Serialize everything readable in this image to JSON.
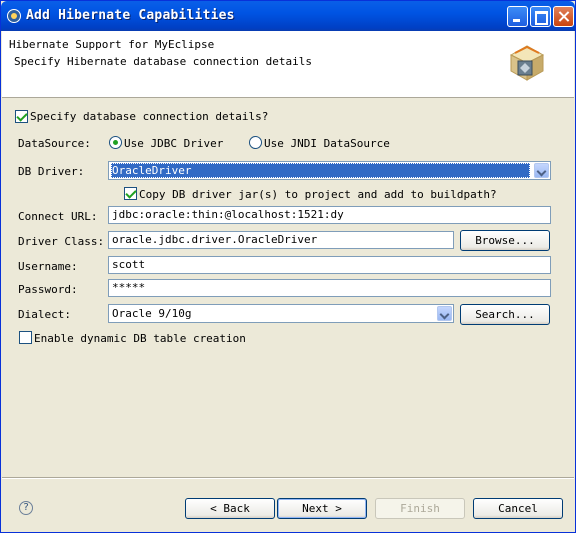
{
  "window": {
    "title": "Add Hibernate Capabilities"
  },
  "header": {
    "title": "Hibernate Support for MyEclipse",
    "description": "Specify Hibernate database connection details",
    "icon": "hibernate-banner-icon"
  },
  "form": {
    "specify_details_label": "Specify database connection details?",
    "specify_details_checked": true,
    "datasource_label": "DataSource:",
    "use_jdbc_label": "Use JDBC Driver",
    "use_jndi_label": "Use JNDI DataSource",
    "selected_source": "jdbc",
    "db_driver_label": "DB Driver:",
    "db_driver_value": "OracleDriver",
    "copy_jar_label": "Copy DB driver jar(s) to project and add to buildpath?",
    "copy_jar_checked": true,
    "connect_url_label": "Connect URL:",
    "connect_url_value": "jdbc:oracle:thin:@localhost:1521:dy",
    "driver_class_label": "Driver Class:",
    "driver_class_value": "oracle.jdbc.driver.OracleDriver",
    "browse_label": "Browse...",
    "username_label": "Username:",
    "username_value": "scott",
    "password_label": "Password:",
    "password_value": "*****",
    "dialect_label": "Dialect:",
    "dialect_value": "Oracle 9/10g",
    "search_label": "Search...",
    "dynamic_table_label": "Enable dynamic DB table creation",
    "dynamic_table_checked": false
  },
  "footer": {
    "help": "?",
    "back_label": "< Back",
    "next_label": "Next >",
    "finish_label": "Finish",
    "cancel_label": "Cancel"
  },
  "colors": {
    "titlebar": "#0054e3",
    "dialog_bg": "#ece9d8",
    "selection": "#316ac5"
  }
}
